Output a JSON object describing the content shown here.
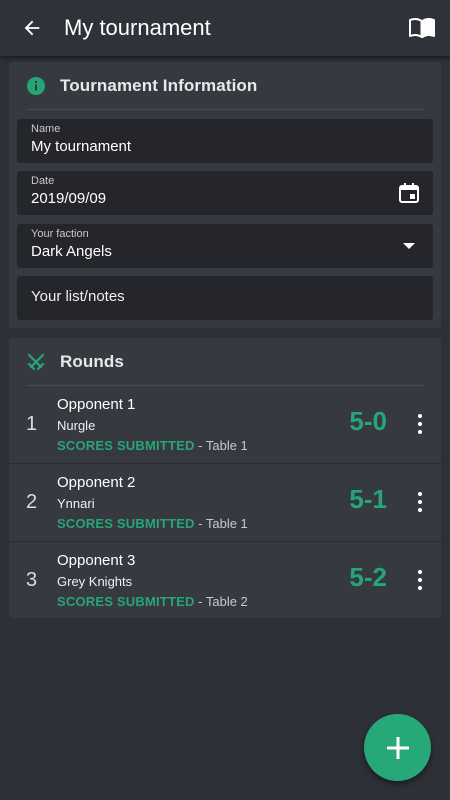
{
  "appbar": {
    "title": "My tournament",
    "back_icon": "arrow-left-icon",
    "book_icon": "book-open-icon"
  },
  "info_card": {
    "header": "Tournament Information",
    "header_icon": "info-circle-icon",
    "name_label": "Name",
    "name_value": "My tournament",
    "date_label": "Date",
    "date_value": "2019/09/09",
    "date_icon": "calendar-icon",
    "faction_label": "Your faction",
    "faction_value": "Dark Angels",
    "faction_icon": "dropdown-arrow-icon",
    "notes_placeholder": "Your list/notes"
  },
  "rounds_card": {
    "header": "Rounds",
    "header_icon": "crossed-swords-icon",
    "rounds": [
      {
        "number": "1",
        "opponent": "Opponent 1",
        "faction": "Nurgle",
        "status": "SCORES SUBMITTED",
        "table": " - Table 1",
        "score": "5-0"
      },
      {
        "number": "2",
        "opponent": "Opponent 2",
        "faction": "Ynnari",
        "status": "SCORES SUBMITTED",
        "table": " - Table 1",
        "score": "5-1"
      },
      {
        "number": "3",
        "opponent": "Opponent 3",
        "faction": "Grey Knights",
        "status": "SCORES SUBMITTED",
        "table": " - Table 2",
        "score": "5-2"
      }
    ]
  },
  "fab": {
    "icon": "plus-icon"
  },
  "colors": {
    "accent": "#26a578",
    "background": "#2e3038",
    "card": "#373941",
    "field": "#24262c"
  }
}
